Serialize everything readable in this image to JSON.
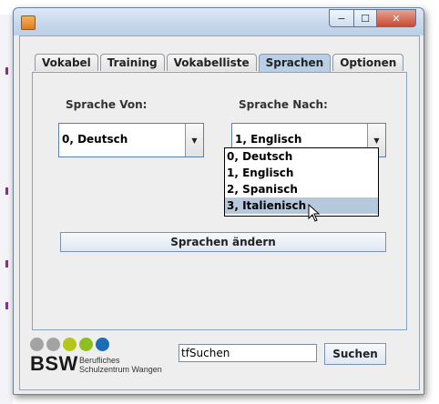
{
  "window": {
    "close_label": "✕",
    "max_label": "☐",
    "min_label": "−"
  },
  "tabs": [
    {
      "label": "Vokabel",
      "active": false
    },
    {
      "label": "Training",
      "active": false
    },
    {
      "label": "Vokabelliste",
      "active": false
    },
    {
      "label": "Sprachen",
      "active": true
    },
    {
      "label": "Optionen",
      "active": false
    }
  ],
  "sprachen": {
    "von_label": "Sprache Von:",
    "von_value": "0, Deutsch",
    "nach_label": "Sprache Nach:",
    "nach_value": "1, Englisch",
    "button_label": "Sprachen ändern",
    "options": [
      "0, Deutsch",
      "1, Englisch",
      "2, Spanisch",
      "3, Italienisch"
    ],
    "hovered_option": "3, Italienisch"
  },
  "footer": {
    "logo_text": "BSW",
    "logo_sub1": "Berufliches",
    "logo_sub2": "Schulzentrum Wangen",
    "search_value": "tfSuchen",
    "search_button": "Suchen"
  },
  "colors": {
    "logo_dots": [
      "#a3a3a3",
      "#a3a3a3",
      "#b6c51a",
      "#8fbf1e",
      "#1d6db5"
    ],
    "active_tab": "#b8cfe5",
    "selected_option": "#b6c8db"
  }
}
